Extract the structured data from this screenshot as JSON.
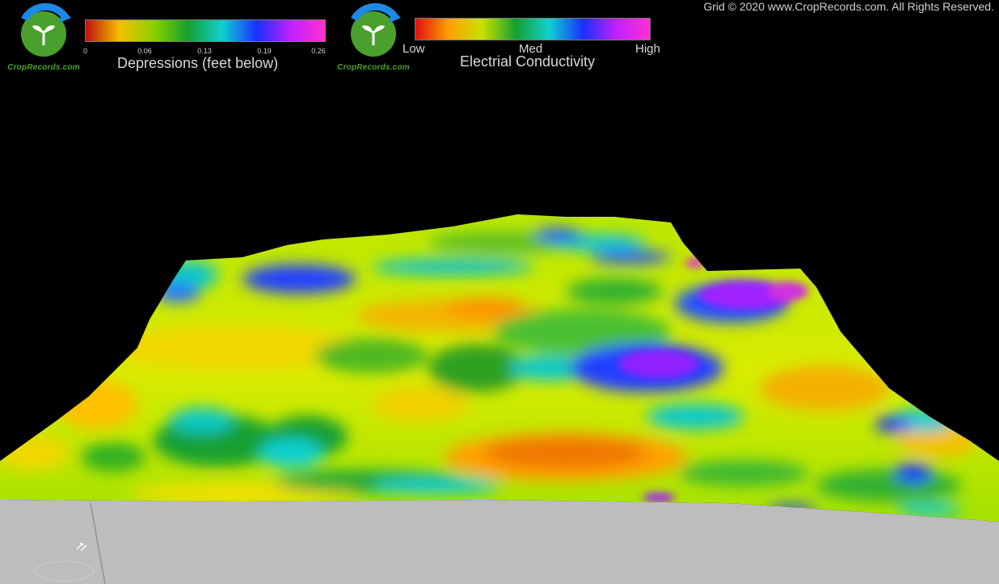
{
  "copyright": "Grid © 2020 www.CropRecords.com. All Rights Reserved.",
  "logo_text": "CropRecords.com",
  "depressions_legend": {
    "title": "Depressions (feet below)",
    "ticks": [
      "0",
      "0.06",
      "0.13",
      "0.19",
      "0.26"
    ],
    "colors": [
      "#c01010",
      "#f5c000",
      "#8ad000",
      "#14a030",
      "#10d0d0",
      "#1830ff",
      "#c020ff",
      "#ff30d0"
    ]
  },
  "ec_legend": {
    "title": "Electrial Conductivity",
    "low": "Low",
    "med": "Med",
    "high": "High",
    "colors": [
      "#e01010",
      "#ffa000",
      "#c8e000",
      "#14a030",
      "#10d0d0",
      "#1830ff",
      "#c020ff",
      "#ff30d0"
    ]
  },
  "palette": {
    "background": "#000000",
    "ground": "#bdbdbd",
    "logo_green": "#4aa02c",
    "logo_blue": "#1e88e5"
  }
}
